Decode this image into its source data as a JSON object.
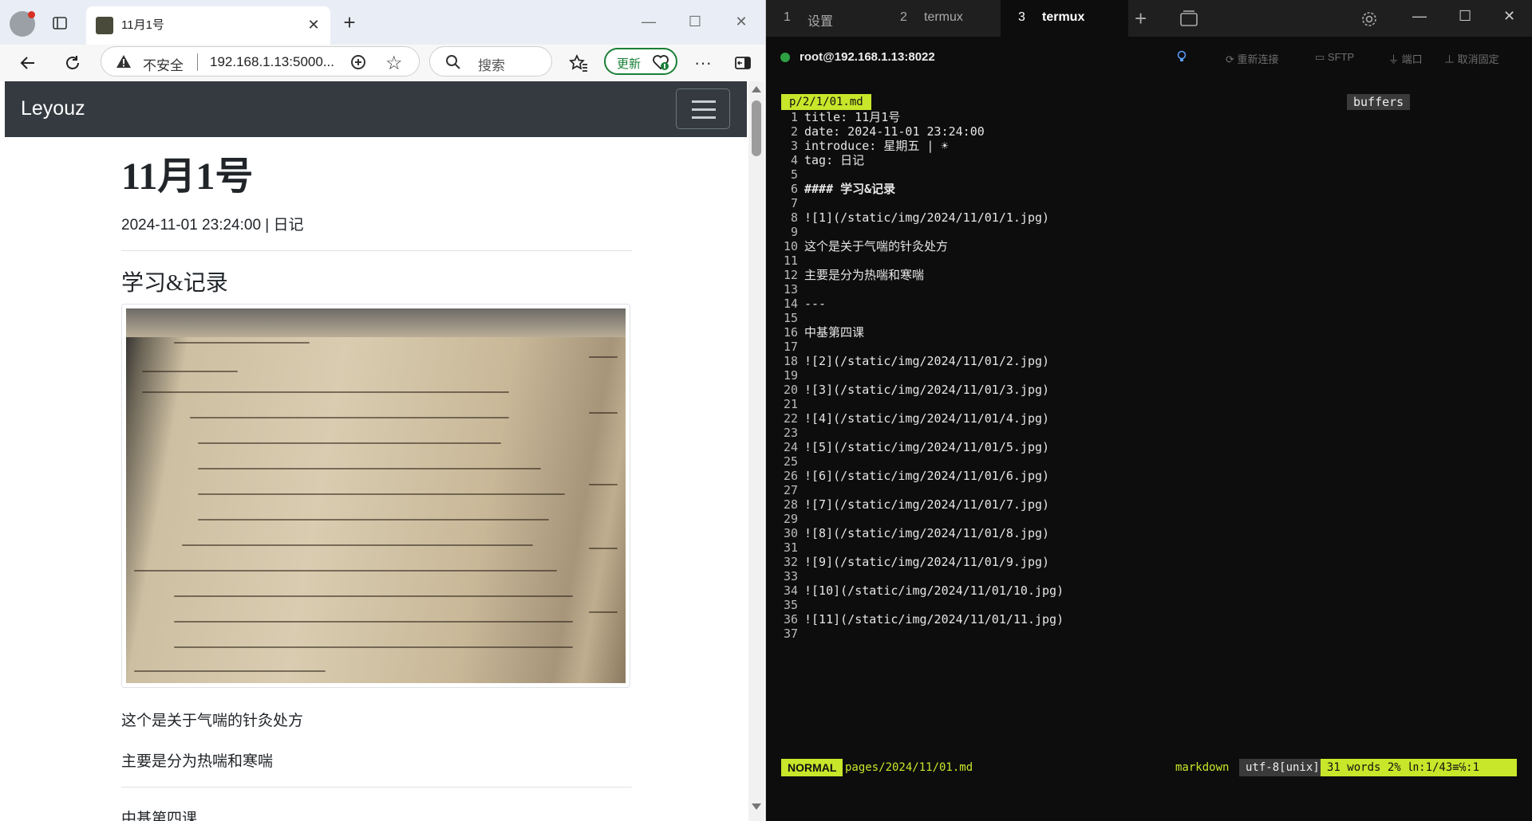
{
  "browser": {
    "tab_title": "11月1号",
    "security_label": "不安全",
    "url": "192.168.1.13:5000...",
    "search_placeholder": "搜索",
    "update_label": "更新"
  },
  "site": {
    "brand": "Leyouz",
    "post": {
      "title": "11月1号",
      "meta": "2024-11-01 23:24:00 | 日记",
      "section": "学习&记录",
      "paragraphs": [
        "这个是关于气喘的针灸处方",
        "主要是分为热喘和寒喘"
      ],
      "next_heading": "中基第四课"
    }
  },
  "terminal": {
    "tabs": [
      {
        "num": "1",
        "label": "设置"
      },
      {
        "num": "2",
        "label": "termux"
      },
      {
        "num": "3",
        "label": "termux"
      }
    ],
    "connection": "root@192.168.1.13:8022",
    "toolbar": {
      "reconnect": "重新连接",
      "sftp": "SFTP",
      "port": "端口",
      "unpin": "取消固定"
    },
    "editor": {
      "buffer_tab": "p/2/1/01.md",
      "buffers_label": "buffers",
      "lines": [
        {
          "n": "1",
          "t": "title: 11月1号"
        },
        {
          "n": "2",
          "t": "date: 2024-11-01 23:24:00"
        },
        {
          "n": "3",
          "t": "introduce: 星期五 | ☀"
        },
        {
          "n": "4",
          "t": "tag: 日记"
        },
        {
          "n": "5",
          "t": ""
        },
        {
          "n": "6",
          "t": "#### 学习&记录"
        },
        {
          "n": "7",
          "t": ""
        },
        {
          "n": "8",
          "t": "![1](/static/img/2024/11/01/1.jpg)"
        },
        {
          "n": "9",
          "t": ""
        },
        {
          "n": "10",
          "t": "这个是关于气喘的针灸处方"
        },
        {
          "n": "11",
          "t": ""
        },
        {
          "n": "12",
          "t": "主要是分为热喘和寒喘"
        },
        {
          "n": "13",
          "t": ""
        },
        {
          "n": "14",
          "t": "---"
        },
        {
          "n": "15",
          "t": ""
        },
        {
          "n": "16",
          "t": "中基第四课"
        },
        {
          "n": "17",
          "t": ""
        },
        {
          "n": "18",
          "t": "![2](/static/img/2024/11/01/2.jpg)"
        },
        {
          "n": "19",
          "t": ""
        },
        {
          "n": "20",
          "t": "![3](/static/img/2024/11/01/3.jpg)"
        },
        {
          "n": "21",
          "t": ""
        },
        {
          "n": "22",
          "t": "![4](/static/img/2024/11/01/4.jpg)"
        },
        {
          "n": "23",
          "t": ""
        },
        {
          "n": "24",
          "t": "![5](/static/img/2024/11/01/5.jpg)"
        },
        {
          "n": "25",
          "t": ""
        },
        {
          "n": "26",
          "t": "![6](/static/img/2024/11/01/6.jpg)"
        },
        {
          "n": "27",
          "t": ""
        },
        {
          "n": "28",
          "t": "![7](/static/img/2024/11/01/7.jpg)"
        },
        {
          "n": "29",
          "t": ""
        },
        {
          "n": "30",
          "t": "![8](/static/img/2024/11/01/8.jpg)"
        },
        {
          "n": "31",
          "t": ""
        },
        {
          "n": "32",
          "t": "![9](/static/img/2024/11/01/9.jpg)"
        },
        {
          "n": "33",
          "t": ""
        },
        {
          "n": "34",
          "t": "![10](/static/img/2024/11/01/10.jpg)"
        },
        {
          "n": "35",
          "t": ""
        },
        {
          "n": "36",
          "t": "![11](/static/img/2024/11/01/11.jpg)"
        },
        {
          "n": "37",
          "t": ""
        }
      ],
      "status": {
        "mode": "NORMAL",
        "file": "pages/2024/11/01.md",
        "filetype": "markdown",
        "encoding": "utf-8[unix]",
        "position": "31 words 2% ㏑:1/43≡℅:1"
      }
    }
  },
  "colors": {
    "navbar_bg": "#343a40",
    "accent_green": "#1a7f37",
    "vim_accent": "#c8e62a",
    "terminal_bg": "#0d0d0d"
  }
}
